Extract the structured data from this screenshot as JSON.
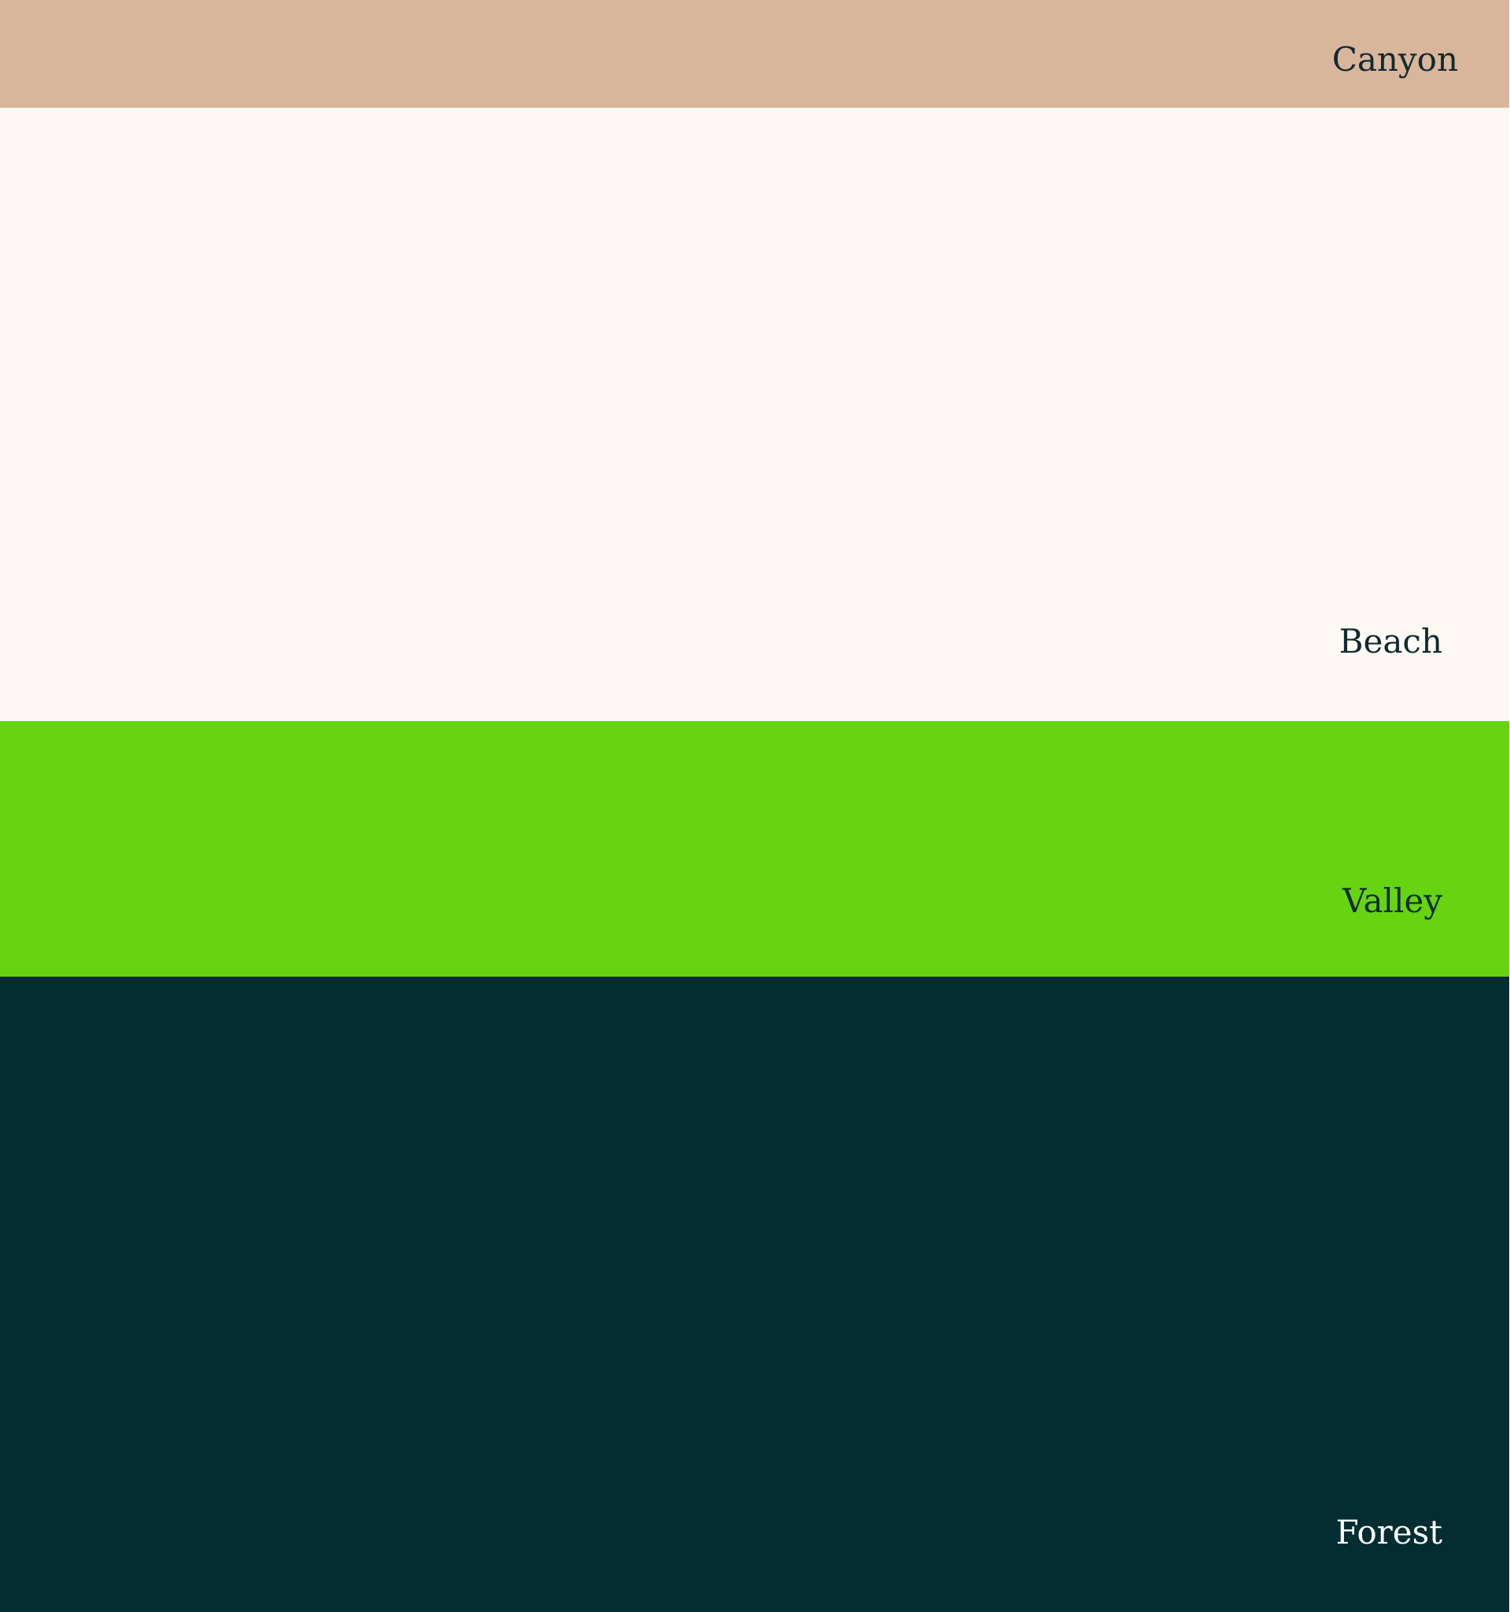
{
  "palette": {
    "swatches": [
      {
        "label": "Canyon",
        "color": "#d9b59b",
        "text_color": "#0f2b2f"
      },
      {
        "label": "Beach",
        "color": "#fff9f3",
        "text_color": "#0f2b2f"
      },
      {
        "label": "Valley",
        "color": "#66d411",
        "text_color": "#0f2b2f"
      },
      {
        "label": "Forest",
        "color": "#042d31",
        "text_color": "#ffffff"
      }
    ]
  }
}
